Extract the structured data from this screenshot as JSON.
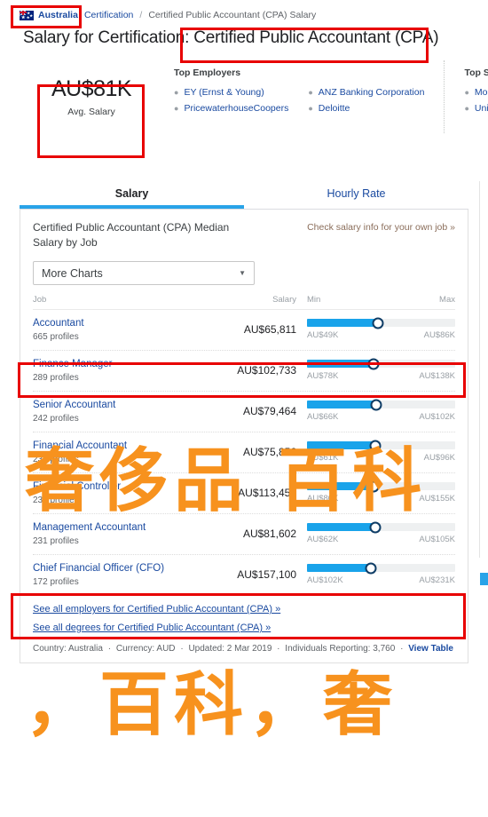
{
  "breadcrumb": {
    "country": "Australia",
    "flag_icon": "australia-flag-icon",
    "section": "Certification",
    "separator": "/",
    "current": "Certified Public Accountant (CPA) Salary"
  },
  "page_title": {
    "prefix": "Salary for Certification:",
    "highlight": "Certified Public Accountant (CPA)",
    "full": "Salary for Certification: Certified Public Accountant (CPA)"
  },
  "summary": {
    "avg_salary_value": "AU$81K",
    "avg_salary_label": "Avg. Salary",
    "employers": {
      "heading": "Top Employers",
      "column_one": [
        "EY (Ernst & Young)",
        "PricewaterhouseCoopers"
      ],
      "column_two": [
        "ANZ Banking Corporation",
        "Deloitte"
      ]
    },
    "schools": {
      "heading": "Top Schools",
      "items": [
        "Monash University",
        "University of Melbourne"
      ]
    }
  },
  "tabs": [
    {
      "label": "Salary",
      "active": true
    },
    {
      "label": "Hourly Rate",
      "active": false
    }
  ],
  "chart_header": {
    "title": "Certified Public Accountant (CPA) Median Salary by Job",
    "check_link": "Check salary info for your own job »",
    "select_value": "More Charts",
    "select_caret": "chevron-down-icon"
  },
  "table_headers": {
    "job": "Job",
    "salary": "Salary",
    "min": "Min",
    "max": "Max"
  },
  "chart_data": {
    "type": "bar",
    "title": "Certified Public Accountant (CPA) Median Salary by Job",
    "xlabel": "",
    "ylabel": "",
    "currency": "AUD",
    "categories": [
      "Accountant",
      "Finance Manager",
      "Senior Accountant",
      "Financial Accountant",
      "Financial Controller",
      "Management Accountant",
      "Chief Financial Officer (CFO)"
    ],
    "values": [
      65811,
      102733,
      79464,
      75856,
      113452,
      81602,
      157100
    ],
    "rows": [
      {
        "job": "Accountant",
        "profiles": "665 profiles",
        "salary": "AU$65,811",
        "min": "AU$49K",
        "max": "AU$86K",
        "salary_value": 65811,
        "min_value": 49000,
        "max_value": 86000,
        "fill_pct": 48
      },
      {
        "job": "Finance Manager",
        "profiles": "289 profiles",
        "salary": "AU$102,733",
        "min": "AU$78K",
        "max": "AU$138K",
        "salary_value": 102733,
        "min_value": 78000,
        "max_value": 138000,
        "fill_pct": 45,
        "highlighted": true
      },
      {
        "job": "Senior Accountant",
        "profiles": "242 profiles",
        "salary": "AU$79,464",
        "min": "AU$66K",
        "max": "AU$102K",
        "salary_value": 79464,
        "min_value": 66000,
        "max_value": 102000,
        "fill_pct": 47
      },
      {
        "job": "Financial Accountant",
        "profiles": "236 profiles",
        "salary": "AU$75,856",
        "min": "AU$61K",
        "max": "AU$96K",
        "salary_value": 75856,
        "min_value": 61000,
        "max_value": 96000,
        "fill_pct": 46
      },
      {
        "job": "Financial Controller",
        "profiles": "235 profiles",
        "salary": "AU$113,452",
        "min": "AU$80K",
        "max": "AU$155K",
        "salary_value": 113452,
        "min_value": 80000,
        "max_value": 155000,
        "fill_pct": 45
      },
      {
        "job": "Management Accountant",
        "profiles": "231 profiles",
        "salary": "AU$81,602",
        "min": "AU$62K",
        "max": "AU$105K",
        "salary_value": 81602,
        "min_value": 62000,
        "max_value": 105000,
        "fill_pct": 46
      },
      {
        "job": "Chief Financial Officer (CFO)",
        "profiles": "172 profiles",
        "salary": "AU$157,100",
        "min": "AU$102K",
        "max": "AU$231K",
        "salary_value": 157100,
        "min_value": 102000,
        "max_value": 231000,
        "fill_pct": 43,
        "highlighted": true
      }
    ]
  },
  "footer": {
    "link_employers": "See all employers for Certified Public Accountant (CPA) »",
    "link_degrees": "See all degrees for Certified Public Accountant (CPA) »",
    "meta": {
      "country_label": "Country: Australia",
      "currency_label": "Currency: AUD",
      "updated_label": "Updated: 2 Mar 2019",
      "individuals_label": "Individuals Reporting: 3,760",
      "view_table": "View Table",
      "dot": "·"
    }
  },
  "watermark": {
    "line1": "奢侈品 百科",
    "line2": "，百科，奢"
  },
  "colors": {
    "accent_blue": "#19a3ea",
    "link_blue": "#1a4aa0",
    "annotation_red": "#e80000",
    "watermark_orange": "#f7921e"
  }
}
